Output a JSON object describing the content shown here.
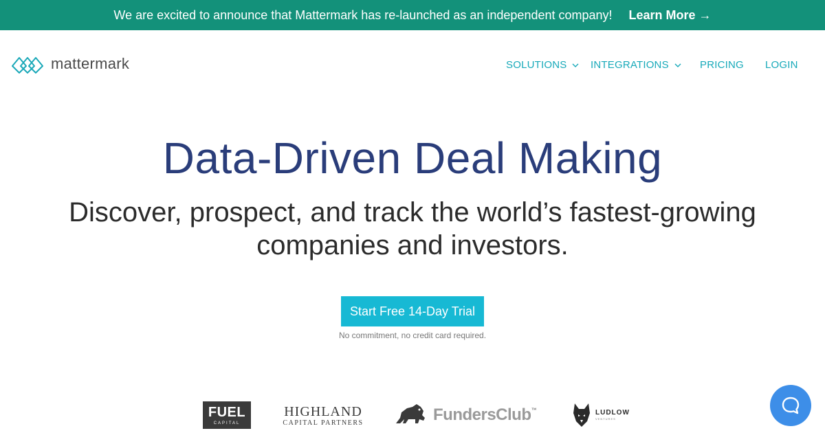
{
  "banner": {
    "message": "We are excited to announce that Mattermark has re-launched as an independent company!",
    "link": "Learn More →"
  },
  "header": {
    "logo_text": "mattermark",
    "logo_icon": "mattermark-logo-icon",
    "nav": [
      {
        "label": "SOLUTIONS",
        "has_dropdown": true
      },
      {
        "label": "INTEGRATIONS",
        "has_dropdown": true
      },
      {
        "label": "PRICING",
        "has_dropdown": false
      },
      {
        "label": "LOGIN",
        "has_dropdown": false
      }
    ]
  },
  "hero": {
    "title": "Data-Driven Deal Making",
    "subtitle_line1": "Discover, prospect, and track the world’s fastest-growing",
    "subtitle_line2": "companies and investors.",
    "cta_label": "Start Free 14-Day Trial",
    "cta_note": "No commitment, no credit card required."
  },
  "customer_logos": {
    "fuel": {
      "big": "FUEL",
      "small": "CAPITAL"
    },
    "highland": {
      "big": "HIGHLAND",
      "small": "CAPITAL PARTNERS"
    },
    "funders": {
      "name": "FundersClub",
      "tm": "™"
    },
    "ludlow": {
      "big": "LUDLOW",
      "small": "VENTURES"
    }
  },
  "chat_widget": {
    "icon": "chat-bubble-icon"
  },
  "colors": {
    "banner_bg": "#13917a",
    "nav_link": "#16a9b9",
    "title": "#2a3d7a",
    "cta_bg": "#17b9d4",
    "chat_bg": "#3d8ee8"
  }
}
